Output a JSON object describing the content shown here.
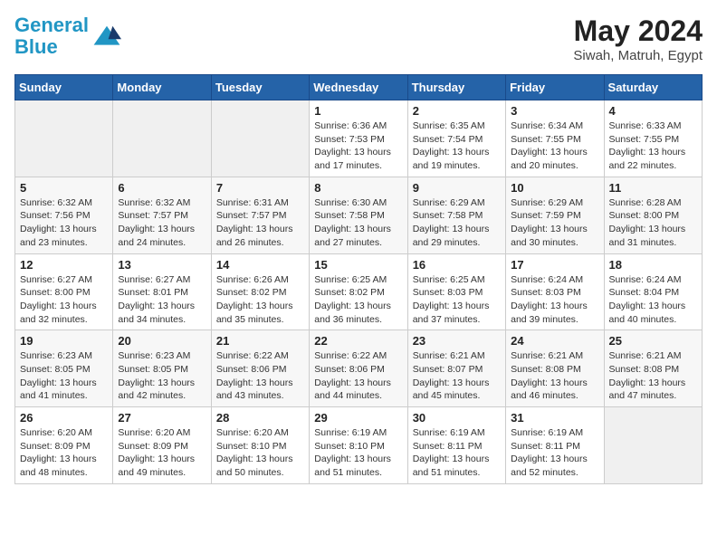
{
  "header": {
    "logo_line1": "General",
    "logo_line2": "Blue",
    "month_title": "May 2024",
    "location": "Siwah, Matruh, Egypt"
  },
  "weekdays": [
    "Sunday",
    "Monday",
    "Tuesday",
    "Wednesday",
    "Thursday",
    "Friday",
    "Saturday"
  ],
  "weeks": [
    [
      {
        "day": "",
        "info": ""
      },
      {
        "day": "",
        "info": ""
      },
      {
        "day": "",
        "info": ""
      },
      {
        "day": "1",
        "info": "Sunrise: 6:36 AM\nSunset: 7:53 PM\nDaylight: 13 hours and 17 minutes."
      },
      {
        "day": "2",
        "info": "Sunrise: 6:35 AM\nSunset: 7:54 PM\nDaylight: 13 hours and 19 minutes."
      },
      {
        "day": "3",
        "info": "Sunrise: 6:34 AM\nSunset: 7:55 PM\nDaylight: 13 hours and 20 minutes."
      },
      {
        "day": "4",
        "info": "Sunrise: 6:33 AM\nSunset: 7:55 PM\nDaylight: 13 hours and 22 minutes."
      }
    ],
    [
      {
        "day": "5",
        "info": "Sunrise: 6:32 AM\nSunset: 7:56 PM\nDaylight: 13 hours and 23 minutes."
      },
      {
        "day": "6",
        "info": "Sunrise: 6:32 AM\nSunset: 7:57 PM\nDaylight: 13 hours and 24 minutes."
      },
      {
        "day": "7",
        "info": "Sunrise: 6:31 AM\nSunset: 7:57 PM\nDaylight: 13 hours and 26 minutes."
      },
      {
        "day": "8",
        "info": "Sunrise: 6:30 AM\nSunset: 7:58 PM\nDaylight: 13 hours and 27 minutes."
      },
      {
        "day": "9",
        "info": "Sunrise: 6:29 AM\nSunset: 7:58 PM\nDaylight: 13 hours and 29 minutes."
      },
      {
        "day": "10",
        "info": "Sunrise: 6:29 AM\nSunset: 7:59 PM\nDaylight: 13 hours and 30 minutes."
      },
      {
        "day": "11",
        "info": "Sunrise: 6:28 AM\nSunset: 8:00 PM\nDaylight: 13 hours and 31 minutes."
      }
    ],
    [
      {
        "day": "12",
        "info": "Sunrise: 6:27 AM\nSunset: 8:00 PM\nDaylight: 13 hours and 32 minutes."
      },
      {
        "day": "13",
        "info": "Sunrise: 6:27 AM\nSunset: 8:01 PM\nDaylight: 13 hours and 34 minutes."
      },
      {
        "day": "14",
        "info": "Sunrise: 6:26 AM\nSunset: 8:02 PM\nDaylight: 13 hours and 35 minutes."
      },
      {
        "day": "15",
        "info": "Sunrise: 6:25 AM\nSunset: 8:02 PM\nDaylight: 13 hours and 36 minutes."
      },
      {
        "day": "16",
        "info": "Sunrise: 6:25 AM\nSunset: 8:03 PM\nDaylight: 13 hours and 37 minutes."
      },
      {
        "day": "17",
        "info": "Sunrise: 6:24 AM\nSunset: 8:03 PM\nDaylight: 13 hours and 39 minutes."
      },
      {
        "day": "18",
        "info": "Sunrise: 6:24 AM\nSunset: 8:04 PM\nDaylight: 13 hours and 40 minutes."
      }
    ],
    [
      {
        "day": "19",
        "info": "Sunrise: 6:23 AM\nSunset: 8:05 PM\nDaylight: 13 hours and 41 minutes."
      },
      {
        "day": "20",
        "info": "Sunrise: 6:23 AM\nSunset: 8:05 PM\nDaylight: 13 hours and 42 minutes."
      },
      {
        "day": "21",
        "info": "Sunrise: 6:22 AM\nSunset: 8:06 PM\nDaylight: 13 hours and 43 minutes."
      },
      {
        "day": "22",
        "info": "Sunrise: 6:22 AM\nSunset: 8:06 PM\nDaylight: 13 hours and 44 minutes."
      },
      {
        "day": "23",
        "info": "Sunrise: 6:21 AM\nSunset: 8:07 PM\nDaylight: 13 hours and 45 minutes."
      },
      {
        "day": "24",
        "info": "Sunrise: 6:21 AM\nSunset: 8:08 PM\nDaylight: 13 hours and 46 minutes."
      },
      {
        "day": "25",
        "info": "Sunrise: 6:21 AM\nSunset: 8:08 PM\nDaylight: 13 hours and 47 minutes."
      }
    ],
    [
      {
        "day": "26",
        "info": "Sunrise: 6:20 AM\nSunset: 8:09 PM\nDaylight: 13 hours and 48 minutes."
      },
      {
        "day": "27",
        "info": "Sunrise: 6:20 AM\nSunset: 8:09 PM\nDaylight: 13 hours and 49 minutes."
      },
      {
        "day": "28",
        "info": "Sunrise: 6:20 AM\nSunset: 8:10 PM\nDaylight: 13 hours and 50 minutes."
      },
      {
        "day": "29",
        "info": "Sunrise: 6:19 AM\nSunset: 8:10 PM\nDaylight: 13 hours and 51 minutes."
      },
      {
        "day": "30",
        "info": "Sunrise: 6:19 AM\nSunset: 8:11 PM\nDaylight: 13 hours and 51 minutes."
      },
      {
        "day": "31",
        "info": "Sunrise: 6:19 AM\nSunset: 8:11 PM\nDaylight: 13 hours and 52 minutes."
      },
      {
        "day": "",
        "info": ""
      }
    ]
  ]
}
